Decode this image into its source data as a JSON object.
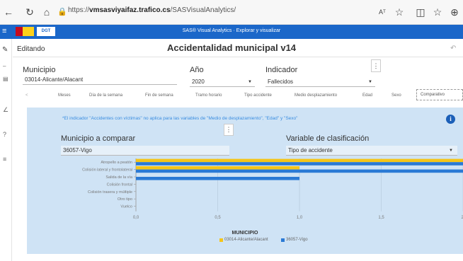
{
  "browser": {
    "url_prefix": "https://",
    "url_host": "vmsasviyaifaz.trafico.cs",
    "url_path": "/SASVisualAnalytics/",
    "zoom_label": "Aᵀ"
  },
  "app": {
    "header_title": "SAS® Visual Analytics · Explorar y visualizar",
    "mode_label": "Editando",
    "report_title": "Accidentalidad municipal v14"
  },
  "filters": {
    "municipio_label": "Municipio",
    "municipio_value": "03014-Alicante/Alacant",
    "anio_label": "Año",
    "anio_value": "2020",
    "indicador_label": "Indicador",
    "indicador_value": "Fallecidos"
  },
  "tabs": [
    "Meses",
    "Día de la semana",
    "Fin de semana",
    "Tramo horario",
    "Tipo accidente",
    "Medio desplazamiento",
    "Edad",
    "Sexo",
    "Comparativo"
  ],
  "panel": {
    "note": "*El indicador \"Accidentes con víctimas\" no aplica para las variables de \"Medio de desplazamiento\", \"Edad\" y \"Sexo\"",
    "compare_label": "Municipio a comparar",
    "compare_value": "36057-Vigo",
    "classif_label": "Variable de clasificación",
    "classif_value": "Tipo de accidente"
  },
  "chart_data": {
    "type": "bar",
    "orientation": "horizontal",
    "categories": [
      "Atropello a peatón",
      "Colisión lateral y frontolateral",
      "Salida de la vía",
      "Colisión frontal",
      "Colisión trasera y múltiple",
      "Otro tipo",
      "Vuelco"
    ],
    "series": [
      {
        "name": "03014-Alicante/Alacant",
        "color": "#f5c518",
        "values": [
          2,
          1,
          0,
          0,
          0,
          0,
          0
        ]
      },
      {
        "name": "36057-Vigo",
        "color": "#2a7ad5",
        "values": [
          2,
          2,
          1,
          0,
          0,
          0,
          0
        ]
      }
    ],
    "xlabel": "MUNICIPIO",
    "xticks": [
      "0,0",
      "0,5",
      "1,0",
      "1,5",
      "2,"
    ],
    "xlim": [
      0,
      2
    ]
  }
}
